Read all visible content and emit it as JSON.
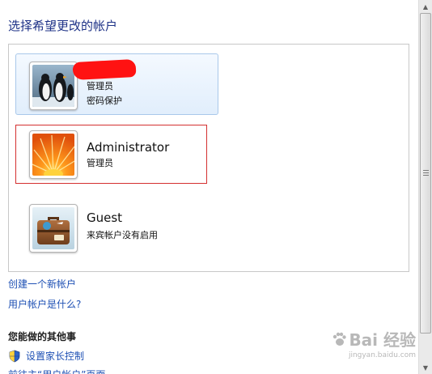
{
  "page": {
    "title": "选择希望更改的帐户"
  },
  "accounts": [
    {
      "name": "",
      "type": "管理员",
      "status": "密码保护",
      "avatar": "penguins-icon"
    },
    {
      "name": "Administrator",
      "type": "管理员",
      "status": "",
      "avatar": "flower-icon"
    },
    {
      "name": "Guest",
      "type": "来宾帐户没有启用",
      "status": "",
      "avatar": "suitcase-icon"
    }
  ],
  "links": {
    "create_account": "创建一个新帐户",
    "what_is_account": "用户帐户是什么?"
  },
  "other_tasks": {
    "heading": "您能做的其他事",
    "parental_controls": "设置家长控制",
    "goto_main": "前往主“用户帐户”页面"
  },
  "watermark": {
    "logo": "Bai 经验",
    "url": "jingyan.baidu.com"
  },
  "colors": {
    "title": "#1e3287",
    "link": "#1e50b4",
    "hover_bg": "#e1eefc",
    "selection_border": "#d43030",
    "redaction": "#ff1212"
  }
}
